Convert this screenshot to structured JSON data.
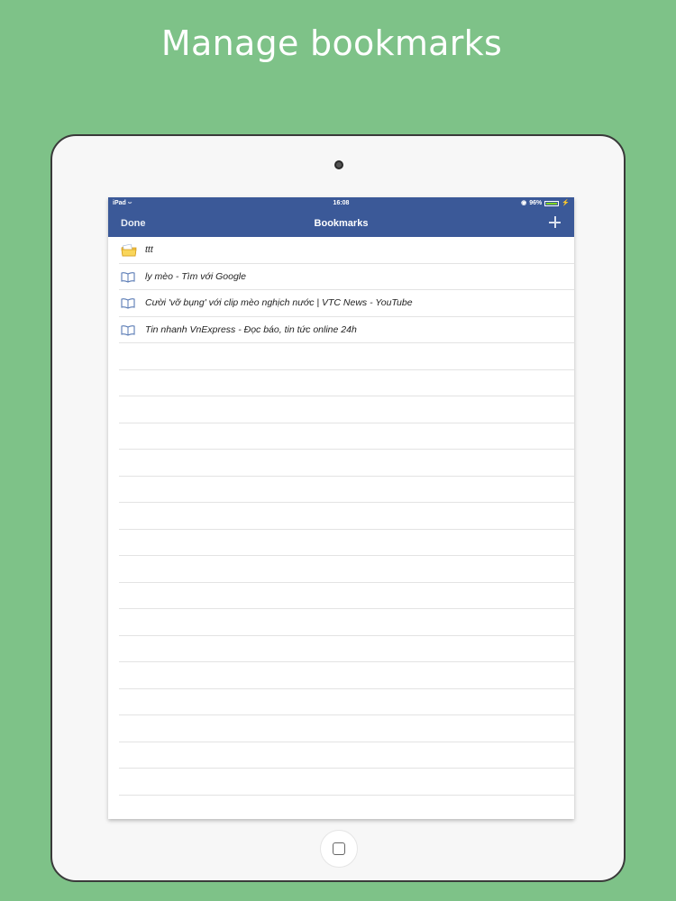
{
  "headline": "Manage bookmarks",
  "status_bar": {
    "device": "iPad",
    "time": "16:08",
    "battery": "96%",
    "battery_level": 0.96
  },
  "nav": {
    "done_label": "Done",
    "title": "Bookmarks"
  },
  "bookmarks": [
    {
      "label": "ttt",
      "icon": "folder-icon"
    },
    {
      "label": "ly mèo - Tìm với Google",
      "icon": "book-icon"
    },
    {
      "label": "Cười 'vỡ bụng' với clip mèo nghịch nước | VTC News - YouTube",
      "icon": "book-icon"
    },
    {
      "label": "Tin nhanh VnExpress - Đọc báo, tin tức online 24h",
      "icon": "book-icon"
    }
  ]
}
